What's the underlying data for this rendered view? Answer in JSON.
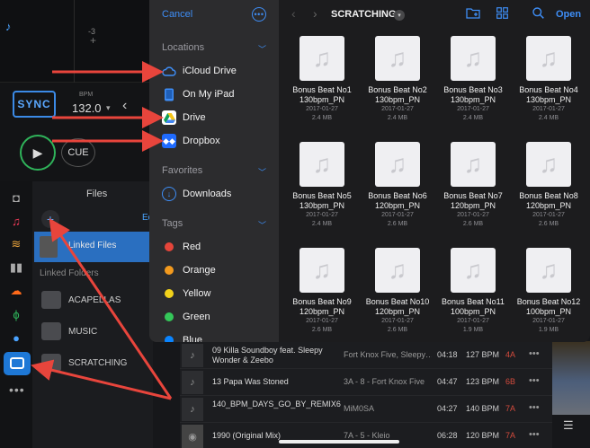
{
  "deck": {
    "minus_label": "-3",
    "sync_label": "SYNC",
    "bpm_label": "BPM",
    "bpm_value": "132.0",
    "cue_label": "CUE"
  },
  "files_panel": {
    "title": "Files",
    "edit_label": "Ed",
    "linked_files_label": "Linked Files",
    "linked_folders_label": "Linked Folders",
    "folders": [
      "ACAPELLAS",
      "MUSIC",
      "SCRATCHING"
    ]
  },
  "tracks": [
    {
      "title": "09 Killa Soundboy feat. Sleepy Wonder & Zeebo",
      "artist": "Fort Knox Five, Sleepy…",
      "time": "04:18",
      "bpm": "127 BPM",
      "key": "4A"
    },
    {
      "title": "13 Papa Was Stoned",
      "artist": "3A - 8 - Fort Knox Five",
      "time": "04:47",
      "bpm": "123 BPM",
      "key": "6B"
    },
    {
      "title": "140_BPM_DAYS_GO_BY_REMIX6",
      "artist": "MiM0SA",
      "time": "04:27",
      "bpm": "140 BPM",
      "key": "7A"
    },
    {
      "title": "1990 (Original Mix)",
      "artist": "7A - 5 - Kleio",
      "time": "06:28",
      "bpm": "120 BPM",
      "key": "7A"
    }
  ],
  "picker": {
    "cancel_label": "Cancel",
    "sections": {
      "locations": "Locations",
      "favorites": "Favorites",
      "tags": "Tags"
    },
    "locations": [
      "iCloud Drive",
      "On My iPad",
      "Drive",
      "Dropbox"
    ],
    "favorites": [
      "Downloads"
    ],
    "tags": [
      {
        "label": "Red",
        "color": "#e5453a"
      },
      {
        "label": "Orange",
        "color": "#f39a1e"
      },
      {
        "label": "Yellow",
        "color": "#f2d21b"
      },
      {
        "label": "Green",
        "color": "#34c759"
      },
      {
        "label": "Blue",
        "color": "#0a84ff"
      }
    ],
    "folder_title": "SCRATCHING",
    "open_label": "Open",
    "files": [
      {
        "name": "Bonus Beat No1 130bpm_PN",
        "date": "2017-01-27",
        "size": "2.4 MB"
      },
      {
        "name": "Bonus Beat No2 130bpm_PN",
        "date": "2017-01-27",
        "size": "2.4 MB"
      },
      {
        "name": "Bonus Beat No3 130bpm_PN",
        "date": "2017-01-27",
        "size": "2.4 MB"
      },
      {
        "name": "Bonus Beat No4 130bpm_PN",
        "date": "2017-01-27",
        "size": "2.4 MB"
      },
      {
        "name": "Bonus Beat No5 130bpm_PN",
        "date": "2017-01-27",
        "size": "2.4 MB"
      },
      {
        "name": "Bonus Beat No6 120bpm_PN",
        "date": "2017-01-27",
        "size": "2.6 MB"
      },
      {
        "name": "Bonus Beat No7 120bpm_PN",
        "date": "2017-01-27",
        "size": "2.6 MB"
      },
      {
        "name": "Bonus Beat No8 120bpm_PN",
        "date": "2017-01-27",
        "size": "2.6 MB"
      },
      {
        "name": "Bonus Beat No9 120bpm_PN",
        "date": "2017-01-27",
        "size": "2.6 MB"
      },
      {
        "name": "Bonus Beat No10 120bpm_PN",
        "date": "2017-01-27",
        "size": "2.6 MB"
      },
      {
        "name": "Bonus Beat No11 100bpm_PN",
        "date": "2017-01-27",
        "size": "1.9 MB"
      },
      {
        "name": "Bonus Beat No12 100bpm_PN",
        "date": "2017-01-27",
        "size": "1.9 MB"
      }
    ]
  },
  "colors": {
    "accent": "#3e8ef7",
    "arrow": "#e8453c",
    "sync": "#3b8ae6",
    "play": "#2fb35a",
    "selected": "#1e78d6"
  },
  "icons": {
    "locations": [
      "cloud-icon",
      "ipad-icon",
      "google-drive-icon",
      "dropbox-icon"
    ],
    "favorites": [
      "download-icon"
    ]
  }
}
